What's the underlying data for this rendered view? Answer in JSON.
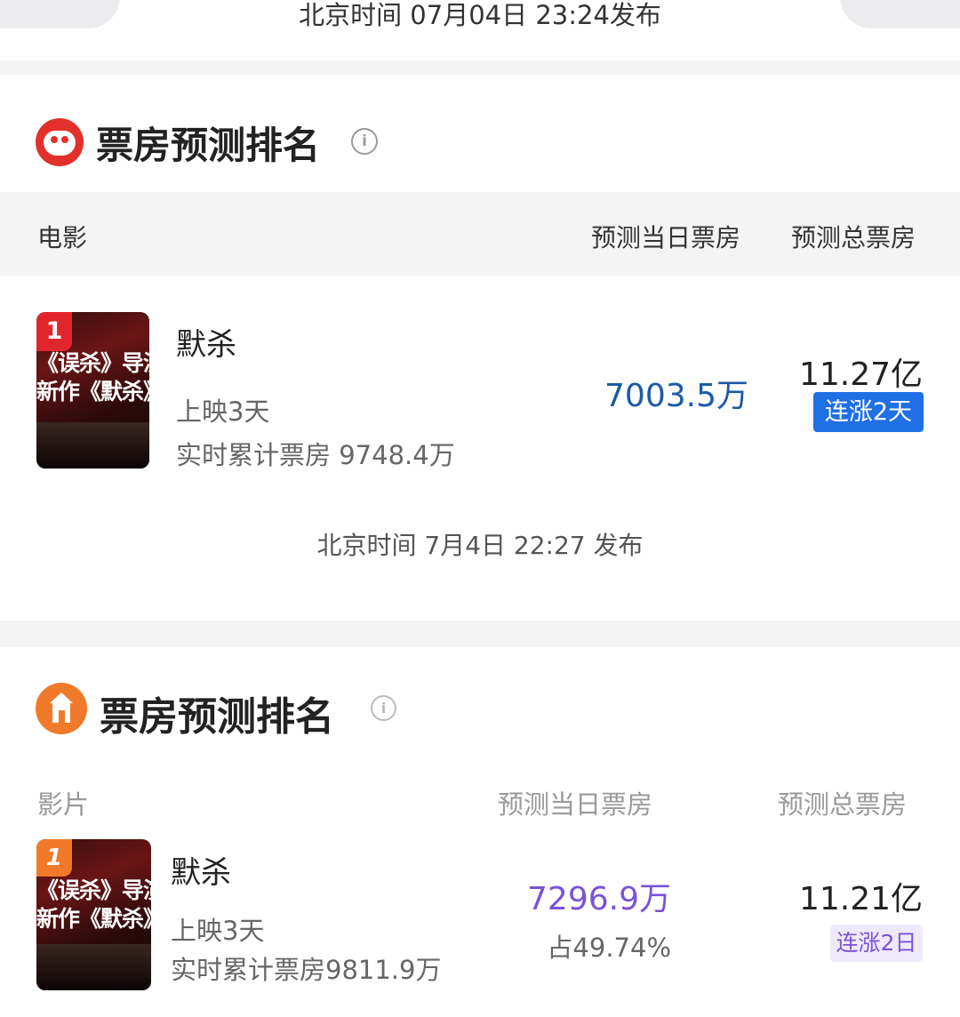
{
  "top": {
    "publish_time": "北京时间  07月04日  23:24发布"
  },
  "maoyan": {
    "title": "票房预测排名",
    "info_icon": "info-circle-icon",
    "logo_icon": "cat-logo-icon",
    "headers": {
      "movie": "电影",
      "day_box": "预测当日票房",
      "total_box": "预测总票房"
    },
    "movie": {
      "rank": "1",
      "poster_text": [
        "《误杀》导演",
        "新作《默杀》"
      ],
      "name": "默杀",
      "days": "上映3天",
      "cumulative": "实时累计票房 9748.4万",
      "day_forecast": "7003.5万",
      "total_forecast": "11.27亿",
      "badge": "连涨2天"
    },
    "publish_time": "北京时间 7月4日 22:27 发布",
    "colors": {
      "accent": "#e2302a",
      "day_value": "#1b5aa7",
      "badge_bg": "#1f6fe5"
    }
  },
  "taopiaopiao": {
    "title": "票房预测排名",
    "info_icon": "info-circle-icon",
    "logo_icon": "cinema-logo-icon",
    "headers": {
      "movie": "影片",
      "day_box": "预测当日票房",
      "total_box": "预测总票房"
    },
    "movie": {
      "rank": "1",
      "poster_text": [
        "《误杀》导演",
        "新作《默杀》"
      ],
      "name": "默杀",
      "days": "上映3天",
      "cumulative": "实时累计票房9811.9万",
      "day_forecast": "7296.9万",
      "share": "占49.74%",
      "total_forecast": "11.21亿",
      "badge": "连涨2日"
    },
    "colors": {
      "accent": "#f07a2a",
      "day_value": "#7a52d8",
      "badge_bg": "#efeafb"
    }
  }
}
